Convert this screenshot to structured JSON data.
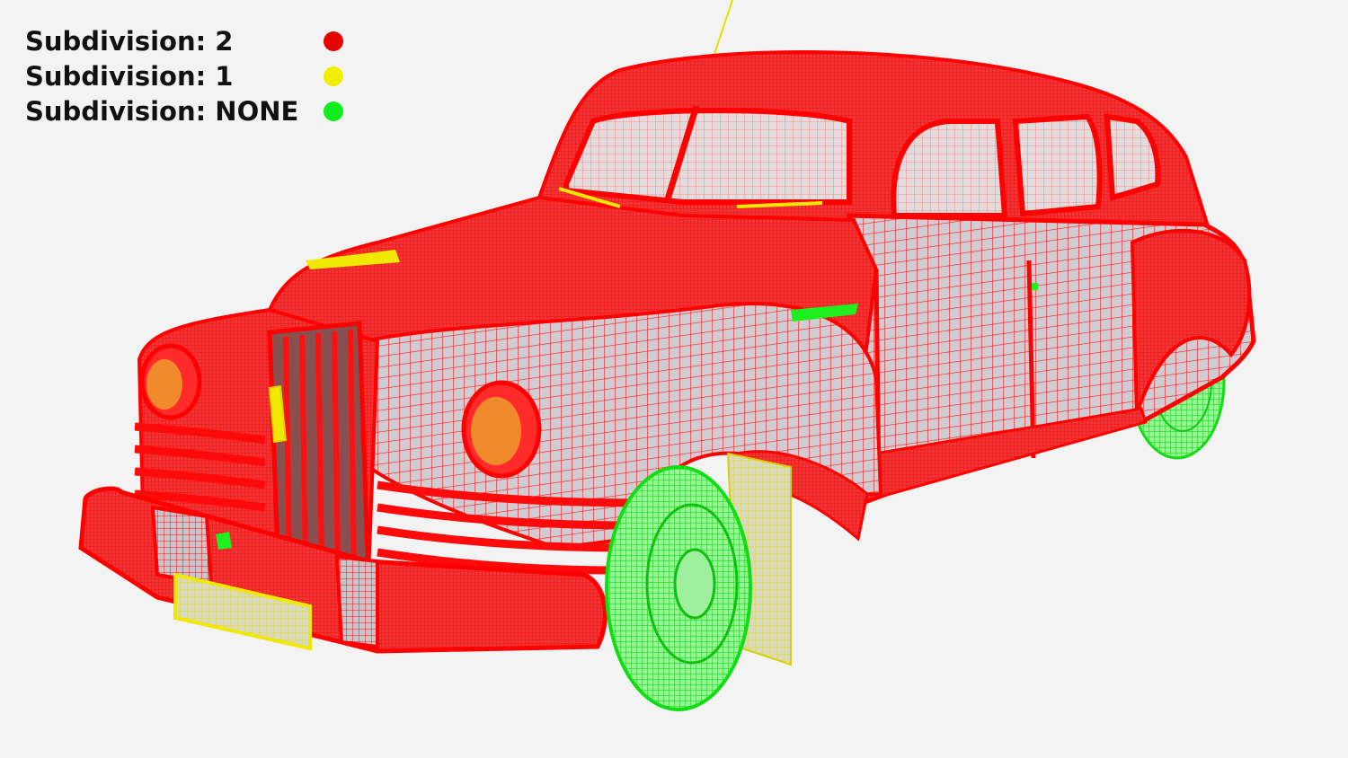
{
  "legend": {
    "items": [
      {
        "label": "Subdivision:  2",
        "color": "#e80000"
      },
      {
        "label": "Subdivision:  1",
        "color": "#f2ee00"
      },
      {
        "label": "Subdivision:  NONE",
        "color": "#10ee20"
      }
    ]
  },
  "colors": {
    "background": "#f3f3f3",
    "body_wire": "#ff1010",
    "body_fill": "#c9c6cc",
    "wheel_wire": "#22ee22",
    "accent_yellow": "#f0e800"
  },
  "scene": {
    "subject": "car-wireframe-mesh"
  }
}
